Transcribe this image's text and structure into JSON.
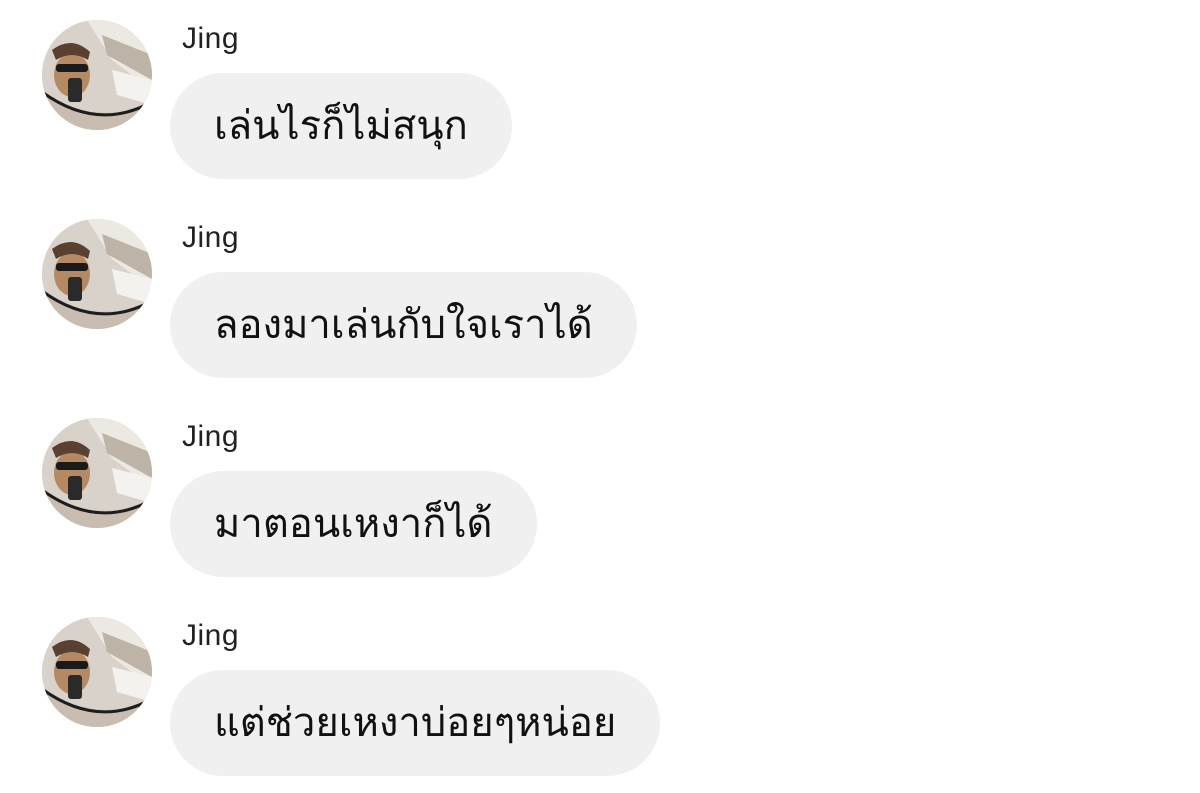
{
  "messages": [
    {
      "sender": "Jing",
      "text": "เล่นไรก็ไม่สนุก"
    },
    {
      "sender": "Jing",
      "text": "ลองมาเล่นกับใจเราได้"
    },
    {
      "sender": "Jing",
      "text": "มาตอนเหงาก็ได้"
    },
    {
      "sender": "Jing",
      "text": "แต่ช่วยเหงาบ่อยๆหน่อย"
    }
  ],
  "colors": {
    "background": "#ffffff",
    "bubble": "#f0f0f0",
    "text": "#111111",
    "sender": "#222222"
  }
}
